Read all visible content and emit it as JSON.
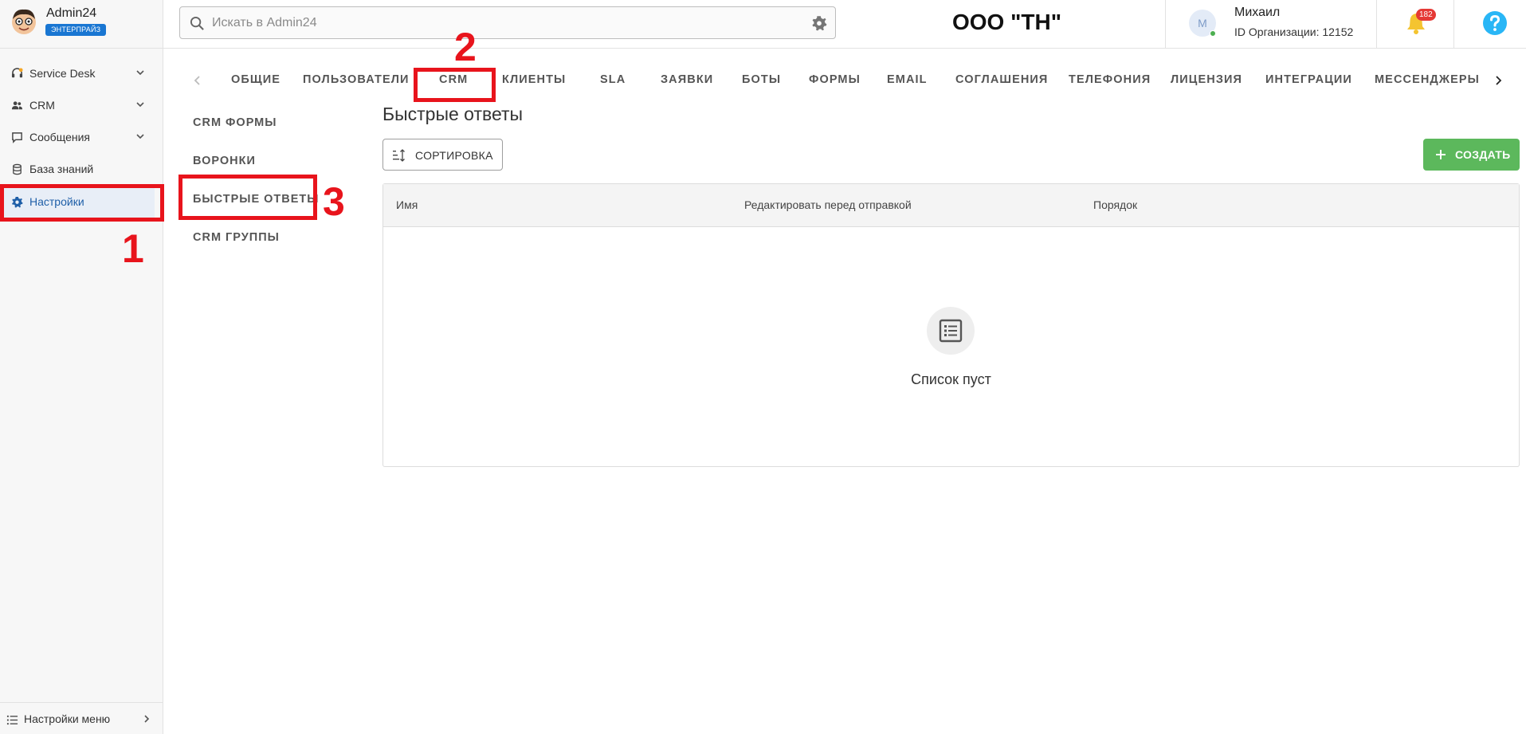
{
  "brand": {
    "name": "Admin24",
    "badge": "ЭНТЕРПРАЙЗ"
  },
  "sidebar": {
    "items": [
      {
        "label": "Service Desk",
        "icon": "headset-icon"
      },
      {
        "label": "CRM",
        "icon": "users-icon"
      },
      {
        "label": "Сообщения",
        "icon": "chat-icon"
      },
      {
        "label": "База знаний",
        "icon": "database-icon"
      },
      {
        "label": "Настройки",
        "icon": "gear-icon",
        "active": true
      }
    ],
    "menu_settings": "Настройки меню"
  },
  "header": {
    "search_placeholder": "Искать в Admin24",
    "org_title": "ООО \"ТН\"",
    "user_initial": "М",
    "user_name": "Михаил",
    "org_id": "ID Организации: 12152",
    "notifications": "182"
  },
  "tabs": [
    "ОБЩИЕ",
    "ПОЛЬЗОВАТЕЛИ",
    "CRM",
    "КЛИЕНТЫ",
    "SLA",
    "ЗАЯВКИ",
    "БОТЫ",
    "ФОРМЫ",
    "EMAIL",
    "СОГЛАШЕНИЯ",
    "ТЕЛЕФОНИЯ",
    "ЛИЦЕНЗИЯ",
    "ИНТЕГРАЦИИ",
    "МЕССЕНДЖЕРЫ"
  ],
  "subnav": [
    "CRM ФОРМЫ",
    "ВОРОНКИ",
    "БЫСТРЫЕ ОТВЕТЫ",
    "CRM ГРУППЫ"
  ],
  "main": {
    "title": "Быстрые ответы",
    "sort_label": "СОРТИРОВКА",
    "create_label": "СОЗДАТЬ",
    "columns": [
      "Имя",
      "Редактировать перед отправкой",
      "Порядок"
    ],
    "empty_text": "Список пуст"
  },
  "annotations": [
    "1",
    "2",
    "3"
  ],
  "colors": {
    "accent": "#1976d2",
    "create": "#5cb85c",
    "annotation": "#e8141c",
    "badge": "#e53935"
  }
}
